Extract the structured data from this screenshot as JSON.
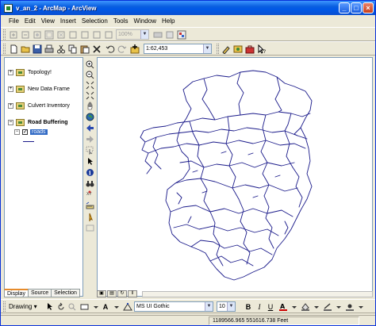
{
  "window": {
    "title": "v_an_2 - ArcMap - ArcView",
    "minimize_glyph": "_",
    "maximize_glyph": "□",
    "close_glyph": "×"
  },
  "menu": {
    "items": [
      "File",
      "Edit",
      "View",
      "Insert",
      "Selection",
      "Tools",
      "Window",
      "Help"
    ]
  },
  "toolbar1": {
    "zoom_value": "100%"
  },
  "toolbar2": {
    "scale_value": "1:62,453"
  },
  "toc": {
    "layers": [
      {
        "name": "Topology!",
        "expander": "+"
      },
      {
        "name": "New Data Frame",
        "expander": "+"
      },
      {
        "name": "Culvert Inventory",
        "expander": "+"
      },
      {
        "name": "Road Buffering",
        "expander": "−"
      }
    ],
    "sublayer": {
      "name": "roads",
      "checked": "✓",
      "expander": "−"
    },
    "tabs": [
      "Display",
      "Source",
      "Selection"
    ]
  },
  "drawbar": {
    "drawing_label": "Drawing ▾",
    "font_name": "MS UI Gothic",
    "font_size": "10",
    "bold_label": "B",
    "italic_label": "I",
    "underline_label": "U",
    "text_label": "A"
  },
  "status": {
    "coordinates": "1189566.965  551616.738 Feet"
  },
  "colors": {
    "title_bar": "#0058e6",
    "map_line": "#1a1a8a",
    "selection": "#316ac5"
  }
}
